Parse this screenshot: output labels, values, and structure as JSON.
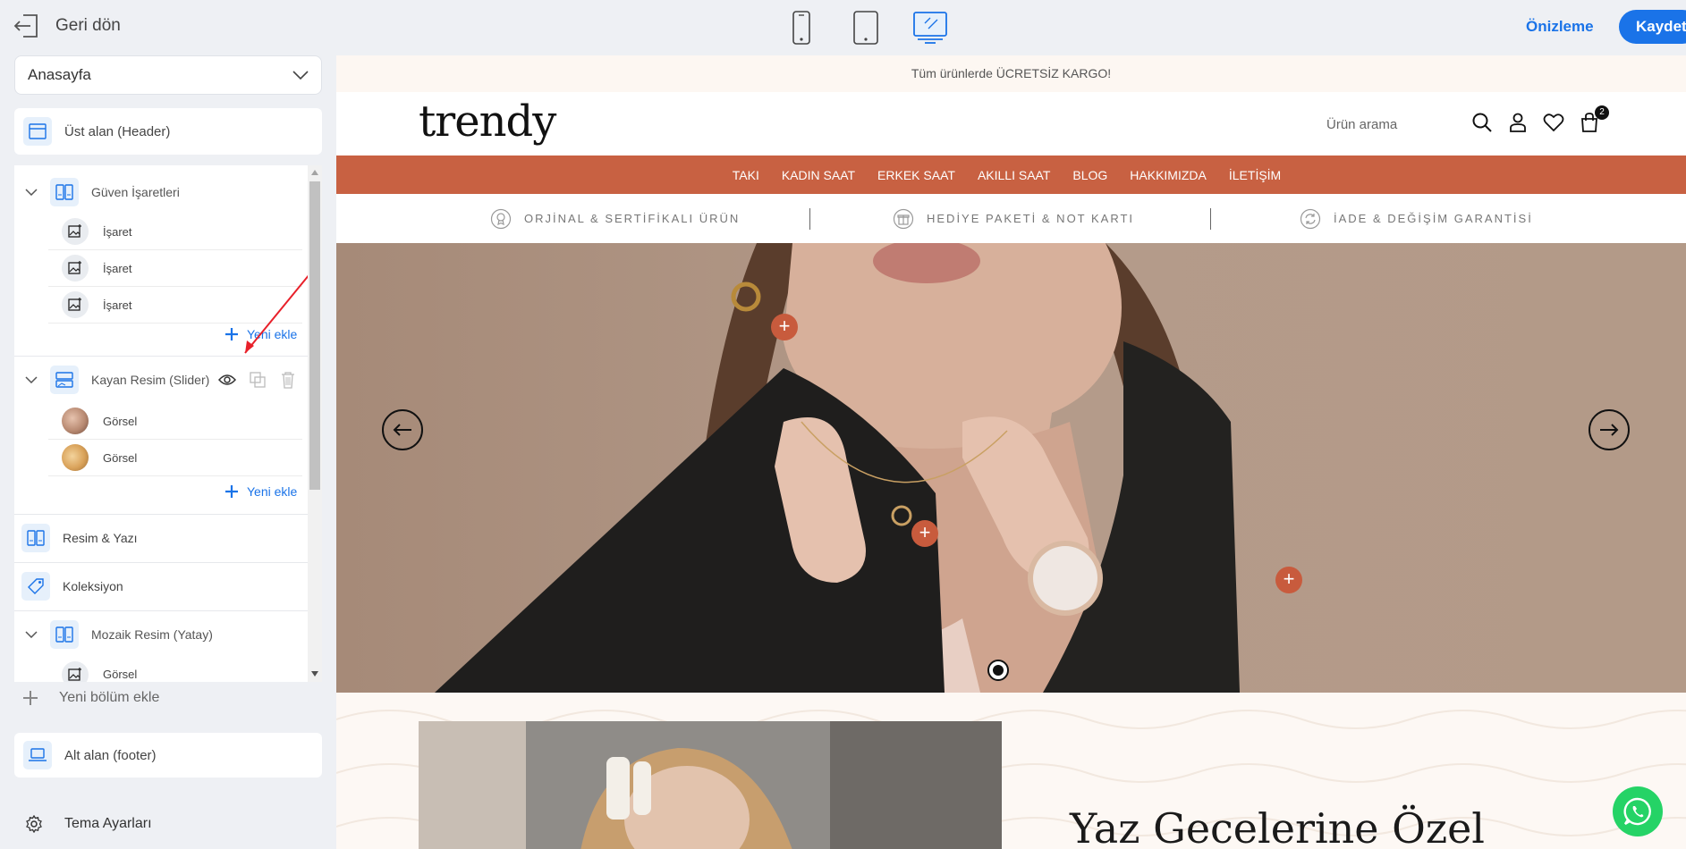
{
  "topbar": {
    "back_label": "Geri dön",
    "preview_label": "Önizleme",
    "save_label": "Kaydet"
  },
  "page_select": {
    "value": "Anasayfa"
  },
  "sections": {
    "header": "Üst alan (Header)",
    "trust": {
      "label": "Güven İşaretleri",
      "items": [
        "İşaret",
        "İşaret",
        "İşaret"
      ],
      "add": "Yeni ekle"
    },
    "slider": {
      "label": "Kayan Resim (Slider)",
      "items": [
        "Görsel",
        "Görsel"
      ],
      "add": "Yeni ekle"
    },
    "image_text": "Resim & Yazı",
    "collection": "Koleksiyon",
    "mosaic": {
      "label": "Mozaik Resim (Yatay)",
      "items": [
        "Görsel"
      ]
    },
    "new_section": "Yeni bölüm ekle",
    "footer": "Alt alan (footer)",
    "theme": "Tema Ayarları"
  },
  "site": {
    "announcement": "Tüm ürünlerde ÜCRETSİZ KARGO!",
    "logo": "trendy",
    "search_placeholder": "Ürün arama",
    "cart_count": "2",
    "nav": [
      "TAKI",
      "KADIN SAAT",
      "ERKEK SAAT",
      "AKILLI SAAT",
      "BLOG",
      "HAKKIMIZDA",
      "İLETİŞİM"
    ],
    "trust": [
      "ORJİNAL & SERTİFİKALI ÜRÜN",
      "HEDİYE PAKETİ & NOT KARTI",
      "İADE & DEĞİŞİM GARANTİSİ"
    ],
    "headline": "Yaz Gecelerine Özel"
  },
  "colors": {
    "accent": "#1a73e8",
    "nav_bg": "#c86142",
    "hotspot": "#c85b3d",
    "whatsapp": "#25d366"
  }
}
